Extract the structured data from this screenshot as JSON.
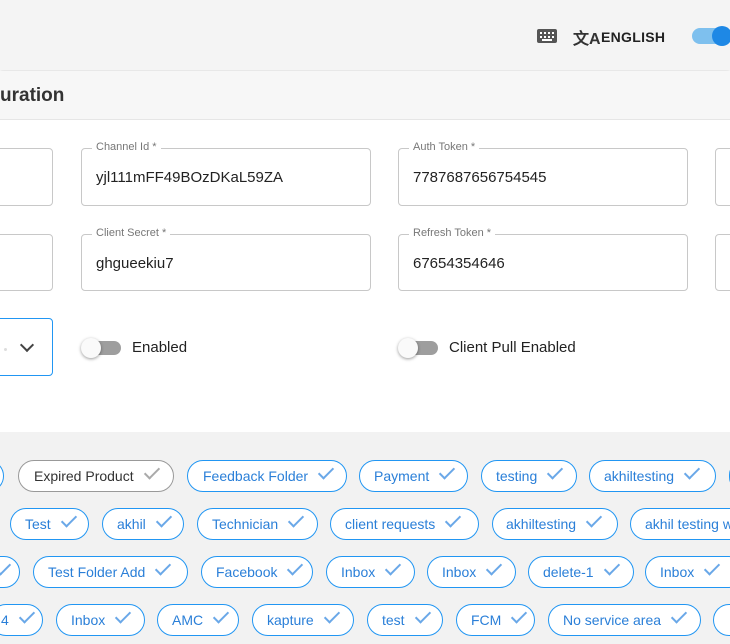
{
  "header": {
    "language": "ENGLISH",
    "keyboard_icon": "keyboard-icon",
    "translate_icon": "translate-icon",
    "translate_glyph": "文A"
  },
  "section": {
    "title": "uration"
  },
  "fields": {
    "channel_id": {
      "label": "Channel Id *",
      "value": "yjl111mFF49BOzDKaL59ZA"
    },
    "auth_token": {
      "label": "Auth Token *",
      "value": "7787687656754545"
    },
    "client_secret": {
      "label": "Client Secret *",
      "value": "ghgueekiu7"
    },
    "refresh_token": {
      "label": "Refresh Token *",
      "value": "67654354646"
    }
  },
  "toggles": {
    "enabled": {
      "label": "Enabled",
      "on": false
    },
    "client_pull": {
      "label": "Client Pull Enabled",
      "on": false
    }
  },
  "chips": {
    "row1": [
      "Expired Product",
      "Feedback Folder",
      "Payment",
      "testing",
      "akhiltesting"
    ],
    "row2": [
      "Test",
      "akhil",
      "Technician",
      "client requests",
      "akhiltesting",
      "akhil testing w"
    ],
    "row3": [
      "Test Folder Add",
      "Facebook",
      "Inbox",
      "Inbox",
      "delete-1",
      "Inbox"
    ],
    "row4": [
      "4",
      "Inbox",
      "AMC",
      "kapture",
      "test",
      "FCM",
      "No service area"
    ]
  },
  "colors": {
    "accent": "#2196f3",
    "chip_text": "#2a7fd8"
  }
}
